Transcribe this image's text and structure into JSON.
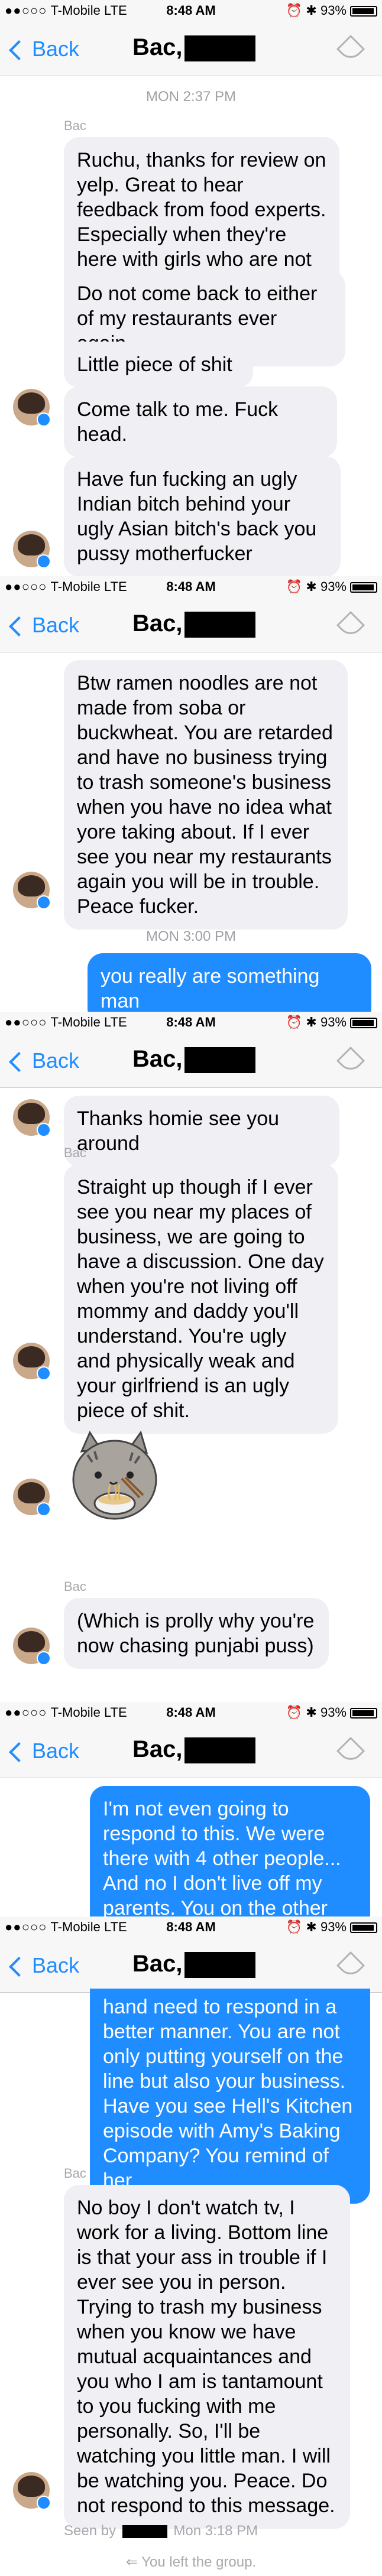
{
  "status_bar": {
    "carrier": "T-Mobile",
    "network": "LTE",
    "time": "8:48 AM",
    "battery": "93%"
  },
  "nav": {
    "back_label": "Back",
    "title": "Bac,"
  },
  "shot1": {
    "timestamp": "MON 2:37 PM",
    "sender": "Bac",
    "messages": [
      "Ruchu, thanks for review on yelp. Great to hear feedback from food experts. Especially when they're here with girls who are not their girlfriend",
      "Do not come back to either of my restaurants ever again.",
      "Little piece of shit",
      "Come talk to me. Fuck head.",
      "Have fun fucking an ugly Indian bitch behind your ugly Asian bitch's back you pussy motherfucker"
    ]
  },
  "shot2": {
    "messages": [
      "Btw ramen noodles are not made from soba or buckwheat. You are retarded and have no business trying to trash someone's business when you have no idea what yore taking about. If I ever see you near my restaurants again you will be in trouble. Peace fucker."
    ],
    "timestamp": "MON 3:00 PM",
    "reply": "you really are something man"
  },
  "shot3": {
    "messages": [
      "Thanks homie see you around",
      "Straight up though if I ever see you near my places of business, we are going to have a discussion. One day when you're not living off mommy and daddy you'll understand. You're ugly and physically weak and your girlfriend is an ugly piece of shit.",
      "(Which is prolly why you're now chasing punjabi puss)"
    ],
    "sender": "Bac",
    "sender2": "Bac"
  },
  "shot4": {
    "reply": "I'm not even going to respond to this. We were there with 4 other people...\nAnd no I don't live off my parents. You on the other"
  },
  "shot5": {
    "reply": "hand need to respond in a better manner. You are not only putting yourself on the line but also your business. Have you see Hell's Kitchen episode with Amy's Baking Company? You remind of her.",
    "sender": "Bac",
    "message": "No boy I don't watch tv, I work for a living. Bottom line is that your ass in trouble if I ever see you in person. Trying to trash my business when you know we have mutual acquaintances and you who I am is tantamount to you fucking with me personally. So, I'll be watching you little man. I will be watching you. Peace. Do not respond to this message.",
    "seen_prefix": "Seen by",
    "seen_time": "Mon 3:18 PM",
    "left_group": "You left the group."
  }
}
